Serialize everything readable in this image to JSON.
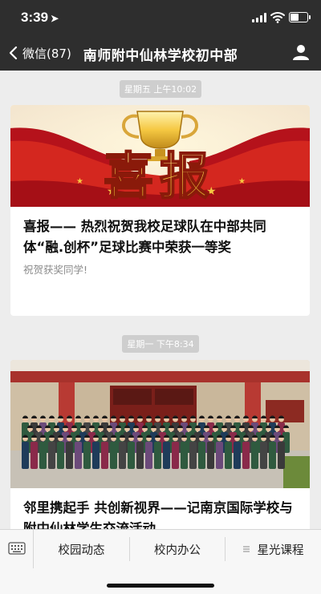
{
  "status_bar": {
    "time": "3:39",
    "location_icon": "location-arrow-icon"
  },
  "nav": {
    "back_label": "微信(87)",
    "title": "南师附中仙林学校初中部",
    "profile_icon": "person-icon"
  },
  "messages": [
    {
      "timestamp": "星期五 上午10:02",
      "cover_text": "喜报",
      "title": "喜报—— 热烈祝贺我校足球队在中部共同体“融.创杯”足球比赛中荣获一等奖",
      "desc": "祝贺获奖同学!"
    },
    {
      "timestamp": "星期一 下午8:34",
      "title": "邻里携起手 共创新视界——记南京国际学校与附中仙林学生交流活动",
      "desc": ""
    }
  ],
  "menu": {
    "keyboard_icon": "keyboard-icon",
    "items": [
      {
        "label": "校园动态"
      },
      {
        "label": "校内办公"
      },
      {
        "label": "星光课程",
        "has_submenu": true
      }
    ]
  },
  "colors": {
    "nav_bg": "#2e2e2e",
    "page_bg": "#ededed",
    "banner_red": "#c8201d",
    "banner_gold": "#f5c842"
  }
}
